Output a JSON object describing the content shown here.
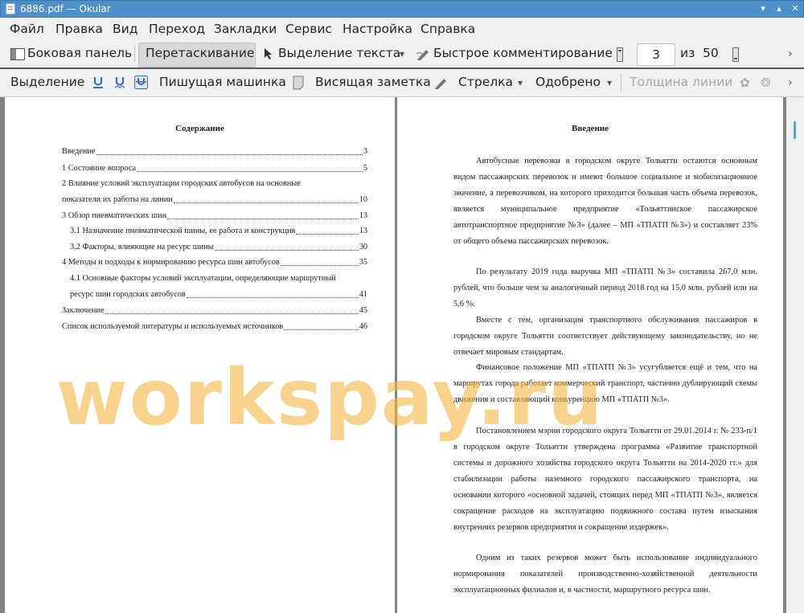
{
  "window": {
    "title": "6886.pdf  — Okular"
  },
  "menu": [
    "Файл",
    "Правка",
    "Вид",
    "Переход",
    "Закладки",
    "Сервис",
    "Настройка",
    "Справка"
  ],
  "toolbar1": {
    "sidebar": "Боковая панель",
    "drag": "Перетаскивание",
    "text_select": "Выделение текста",
    "quick_comment": "Быстрое комментирование",
    "page_current": "3",
    "page_of": "из",
    "page_total": "50"
  },
  "toolbar2": {
    "highlight": "Выделение",
    "typewriter": "Пишущая машинка",
    "sticky_note": "Висящая заметка",
    "arrow": "Стрелка",
    "approved": "Одобрено",
    "line_width": "Толщина линии"
  },
  "left_page": {
    "heading": "Содержание",
    "toc": [
      {
        "title": "Введение",
        "page": "3"
      },
      {
        "title": "1 Состояние вопроса",
        "page": "5"
      },
      {
        "title": "2 Влияние условий эксплуатации городских автобусов на основные",
        "title2": "показатели их работы на линии",
        "page": "10"
      },
      {
        "title": "3 Обзор пневматических шин",
        "page": "13"
      },
      {
        "title": "3.1 Назначение пневматической шины, ее работа и конструкция",
        "page": "13"
      },
      {
        "title": "3.2 Факторы, влияющие на ресурс шины",
        "page": "30"
      },
      {
        "title": "4 Методы и подходы к нормированию ресурса шин автобусов",
        "page": "35"
      },
      {
        "title": "4.1 Основные факторы условий эксплуатации, определяющие маршрутный",
        "title2": "ресурс шин городских автобусов",
        "page": "41"
      },
      {
        "title": "Заключение",
        "page": "45"
      },
      {
        "title": "Список используемой литературы и используемых источников",
        "page": "46"
      }
    ]
  },
  "right_page": {
    "heading": "Введение",
    "paragraphs": [
      "Автобусные перевозки в городском округе Тольятти остаются основным видом пассажирских перевозок и имеют большое социальное и мобилизационное значение, а перевозчиком, на которого приходится большая часть объема перевозок, является муниципальное предприятие «Тольяттинское пассажирское автотранспортное предприятие №3» (далее – МП «ТПАТП №3») и составляет 23% от общего объема пассажирских перевозок.",
      "По результату 2019 года выручка МП «ТПАТП №3» составила 267,0 млн. рублей, что больше чем за аналогичный период 2018 год на 15,0 млн. рублей или на 5,6 %.",
      "Вместе с тем, организация транспортного обслуживания пассажиров в городском округе Тольятти соответствует действующему законодательству, но не отвечает мировым стандартам.",
      "Финансовое положение МП «ТПАТП №3» усугубляется ещё и тем, что на маршрутах города работает коммерческий транспорт, частично дублирующий схемы движения и составляющий конкуренцию МП «ТПАТП №3».",
      "Постановлением мэрии городского округа Тольятти от 29.01.2014 г. № 233-п/1 в городском округе Тольятти утверждена программа «Развитие транспортной системы и дорожного хозяйства городского округа Тольятти на 2014-2020 гг.» для стабилизации работы наземного городского пассажирского транспорта, на основании которого «основной задачей, стоящих перед МП «ТПАТП №3», является сокращение расходов на эксплуатацию подвижного состава путем изыскания внутренних резервов предприятия и сокращение издержек».",
      "Одним из таких резервов может быть использование индивидуального нормирования показателей производственно-хозяйственной деятельности эксплуатационных филиалов и, в частности, маршрутного ресурса шин."
    ]
  },
  "watermark": "workspay.ru"
}
